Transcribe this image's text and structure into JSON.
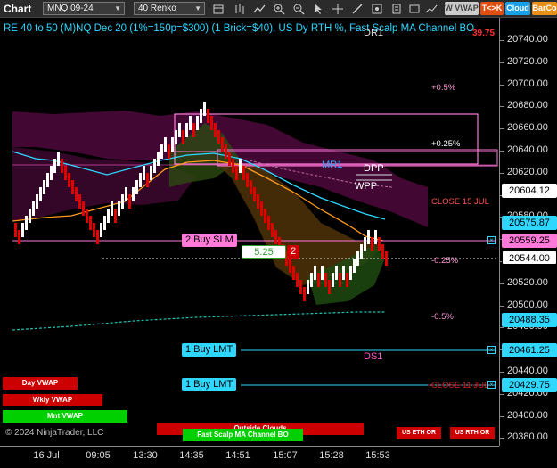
{
  "toolbar": {
    "title": "Chart",
    "instrument": "MNQ 09-24",
    "bar_type": "40 Renko",
    "buttons": {
      "vwap": "W VWAP",
      "tk": "T<>K",
      "cloud": "Cloud",
      "barco": "BarCo"
    }
  },
  "chart": {
    "header": "RE 40 to 50 (M)NQ Dec 20 (1%=150p=$300) (1 Brick=$40), US Dy RTH %, Fast Scalp MA Channel BO",
    "header_value": "39.75",
    "levels": {
      "dr1": "DR1",
      "pct_plus_05": "+0.5%",
      "pct_plus_025": "+0.25%",
      "mr1": "MR1",
      "dpp": "DPP",
      "wpp": "WPP",
      "close_15jul": "CLOSE 15 JUL",
      "pct_minus_025": "-0.25%",
      "pct_minus_05": "-0.5%",
      "ds1": "DS1",
      "close_11jul": "CLOSE 11 JUL"
    },
    "orders": {
      "buy_slm": "2 Buy SLM",
      "buy_lmt_1": "1 Buy LMT",
      "buy_lmt_2": "1 Buy LMT",
      "pnl": "5.25",
      "qty": "2"
    },
    "buttons": {
      "day_vwap": "Day VWAP",
      "wkly_vwap": "Wkly VWAP",
      "mnt_vwap": "Mnt VWAP",
      "outside_clouds": "Outside Clouds",
      "fast_scalp": "Fast Scalp MA Channel BO",
      "us_eth_or": "US ETH OR",
      "us_rth_or": "US RTH OR"
    },
    "watermark": "© 2024 NinjaTrader, LLC"
  },
  "price_axis": {
    "ticks": [
      "20740.00",
      "20720.00",
      "20700.00",
      "20680.00",
      "20660.00",
      "20640.00",
      "20620.00",
      "20600.00",
      "20580.00",
      "20560.00",
      "20540.00",
      "20520.00",
      "20500.00",
      "20480.00",
      "20460.00",
      "20440.00",
      "20420.00",
      "20400.00",
      "20380.00"
    ],
    "tags": {
      "close15": "20604.12",
      "mid": "20575.87",
      "slm": "20559.25",
      "last": "20544.00",
      "lower": "20488.35",
      "lmt1": "20461.25",
      "lmt2": "20429.75"
    }
  },
  "time_axis": {
    "labels": [
      "16 Jul",
      "09:05",
      "13:30",
      "14:35",
      "14:51",
      "15:07",
      "15:28",
      "15:53"
    ]
  },
  "colors": {
    "up": "#ffffff",
    "down": "#e00000",
    "cyan": "#2fd7ff",
    "magenta": "#ff5cd0",
    "cloud": "#5a0a48"
  }
}
